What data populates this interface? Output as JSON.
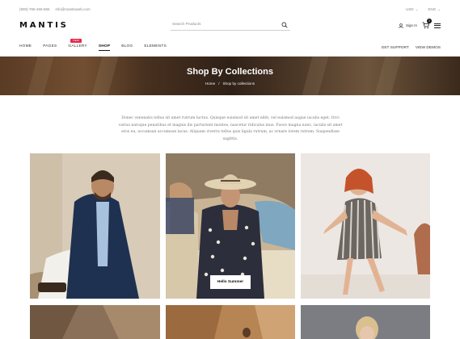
{
  "topbar": {
    "phone": "(800)-765-456-865",
    "email": "info@mantisweb.com",
    "currency": "USD",
    "language": "ENG"
  },
  "header": {
    "logo": "MANTIS",
    "search_placeholder": "Search Products",
    "signin": "Sign In",
    "cart_count": "0"
  },
  "nav": {
    "items": [
      {
        "label": "HOME"
      },
      {
        "label": "PAGES"
      },
      {
        "label": "GALLERY",
        "badge": "NEW"
      },
      {
        "label": "SHOP",
        "active": true
      },
      {
        "label": "BLOG"
      },
      {
        "label": "ELEMENTS"
      }
    ],
    "right": [
      "GET SUPPORT",
      "VIEW DEMOS"
    ]
  },
  "banner": {
    "title": "Shop By Collections",
    "breadcrumb_home": "Home",
    "breadcrumb_sep": "/",
    "breadcrumb_current": "Shop by collections"
  },
  "intro": "Donec venenatis tellus sit amet rutrum luctus. Quisque euismod sit amet nibh, vel euismod augue iaculis eget. Orci varius natoque penatibus et magnis dis parturient montes, nascetur ridiculus mus. Fusce magna nunc, iaculis sit amet eros eu, accumsan accumsan lacus. Aliquam viverra tellus quis ligula rutrum, ac ornare lorem rutrum. Suspendisse sagittis.",
  "collections": [
    {
      "image": "man-in-blue-jacket"
    },
    {
      "image": "woman-in-hat-on-beach",
      "label": "Hello Summer"
    },
    {
      "image": "woman-in-striped-dress"
    },
    {
      "image": "collection-image-4"
    },
    {
      "image": "collection-image-5"
    },
    {
      "image": "collection-image-6"
    }
  ],
  "colors": {
    "badge": "#e6284a",
    "text": "#222222"
  }
}
